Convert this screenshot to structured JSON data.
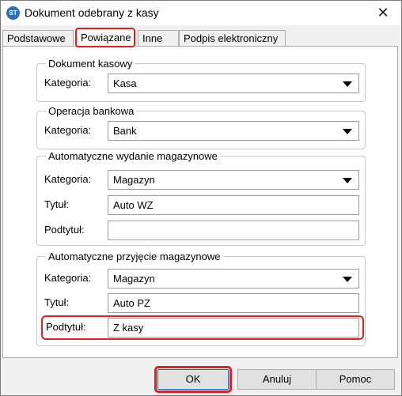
{
  "window": {
    "title": "Dokument odebrany z kasy",
    "app_icon_text": "ST",
    "close_glyph": "✕"
  },
  "tabs": [
    {
      "label": "Podstawowe",
      "active": false
    },
    {
      "label": "Powiązane",
      "active": true
    },
    {
      "label": "Inne",
      "active": false
    },
    {
      "label": "Podpis elektroniczny",
      "active": false
    }
  ],
  "groups": {
    "dokument_kasowy": {
      "title": "Dokument kasowy",
      "kategoria_label": "Kategoria:",
      "kategoria_value": "Kasa"
    },
    "operacja_bankowa": {
      "title": "Operacja bankowa",
      "kategoria_label": "Kategoria:",
      "kategoria_value": "Bank"
    },
    "wydanie": {
      "title": "Automatyczne wydanie magazynowe",
      "kategoria_label": "Kategoria:",
      "kategoria_value": "Magazyn",
      "tytul_label": "Tytuł:",
      "tytul_value": "Auto WZ",
      "podtytul_label": "Podtytuł:",
      "podtytul_value": ""
    },
    "przyjecie": {
      "title": "Automatyczne przyjęcie magazynowe",
      "kategoria_label": "Kategoria:",
      "kategoria_value": "Magazyn",
      "tytul_label": "Tytuł:",
      "tytul_value": "Auto PZ",
      "podtytul_label": "Podtytuł:",
      "podtytul_value": "Z kasy"
    }
  },
  "buttons": {
    "ok": "OK",
    "cancel": "Anuluj",
    "help": "Pomoc"
  },
  "colors": {
    "highlight": "#e02020",
    "focus_border": "#0078d7"
  }
}
